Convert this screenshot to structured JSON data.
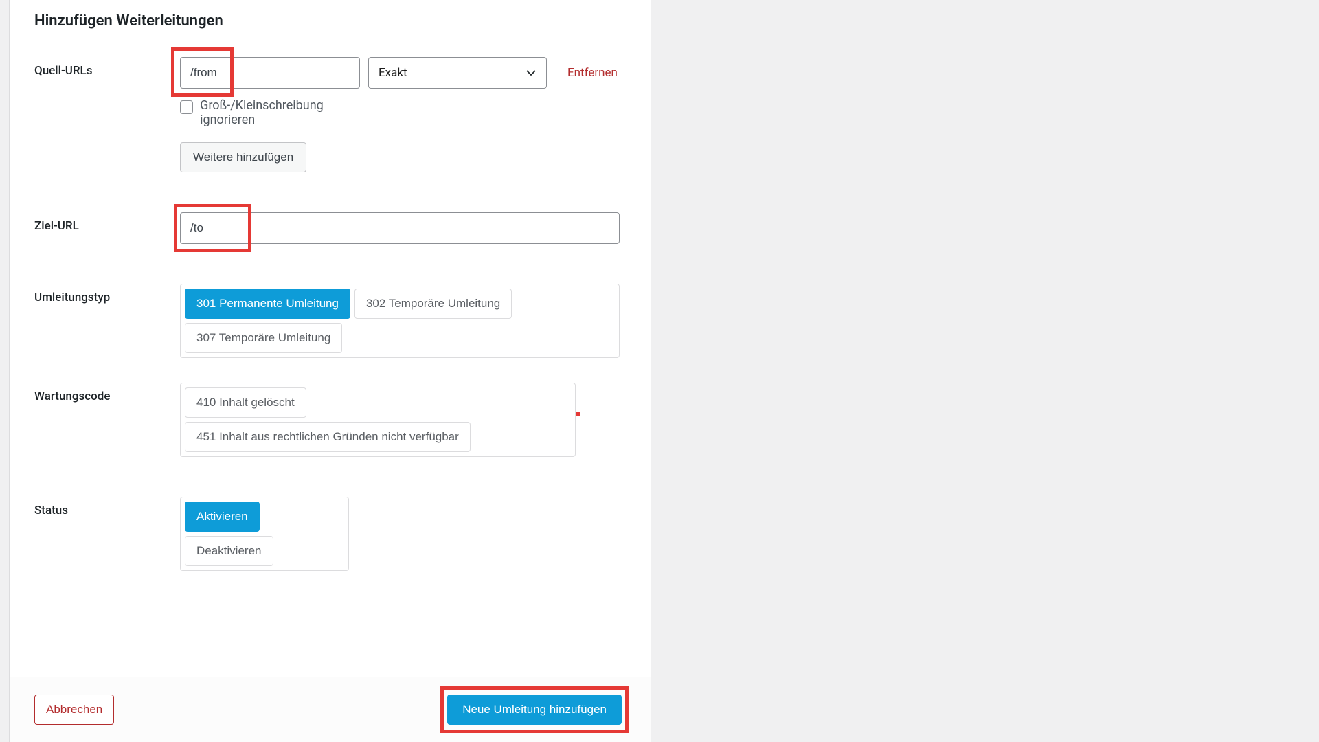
{
  "title": "Hinzufügen Weiterleitungen",
  "labels": {
    "source": "Quell-URLs",
    "target": "Ziel-URL",
    "redirect_type": "Umleitungstyp",
    "maintenance_code": "Wartungscode",
    "status": "Status"
  },
  "source": {
    "value": "/from",
    "match_mode": "Exakt",
    "remove": "Entfernen",
    "ignore_case_label": "Groß-/Kleinschreibung ignorieren",
    "ignore_case_checked": false,
    "add_more": "Weitere hinzufügen"
  },
  "target": {
    "value": "/to"
  },
  "redirect_types": {
    "options": [
      {
        "label": "301 Permanente Umleitung",
        "selected": true
      },
      {
        "label": "302 Temporäre Umleitung",
        "selected": false
      },
      {
        "label": "307 Temporäre Umleitung",
        "selected": false
      }
    ]
  },
  "maintenance_codes": {
    "options": [
      {
        "label": "410 Inhalt gelöscht",
        "selected": false
      },
      {
        "label": "451 Inhalt aus rechtlichen Gründen nicht verfügbar",
        "selected": false
      }
    ]
  },
  "status": {
    "options": [
      {
        "label": "Aktivieren",
        "selected": true
      },
      {
        "label": "Deaktivieren",
        "selected": false
      }
    ]
  },
  "footer": {
    "cancel": "Abbrechen",
    "submit": "Neue Umleitung hinzufügen"
  }
}
